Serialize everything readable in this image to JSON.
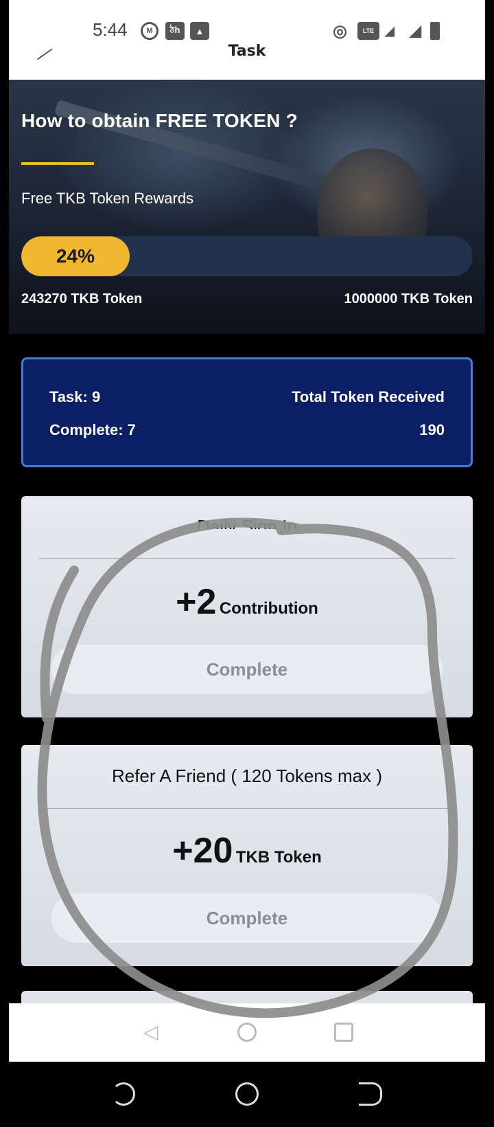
{
  "status_bar": {
    "time": "5:44",
    "icons": [
      "m-badge-icon",
      "app-notification-icon",
      "image-icon",
      "hotspot-icon",
      "volte-icon",
      "4g-signal-icon",
      "signal-icon",
      "battery-icon"
    ]
  },
  "header": {
    "title": "Task"
  },
  "banner": {
    "title": "How to obtain FREE TOKEN ?",
    "subtitle": "Free TKB Token Rewards",
    "progress_label": "24%",
    "progress_fraction": 0.24,
    "current": "243270 TKB Token",
    "target": "1000000 TKB Token",
    "accent_color": "#f2b731"
  },
  "summary": {
    "task": "Task: 9",
    "complete": "Complete: 7",
    "total_label": "Total Token Received",
    "total_value": "190"
  },
  "tasks": [
    {
      "title": "Daily Sign In",
      "amount": "+2",
      "unit": "Contribution",
      "button": "Complete"
    },
    {
      "title": "Refer A Friend ( 120 Tokens max )",
      "amount": "+20",
      "unit": "TKB Token",
      "button": "Complete"
    }
  ]
}
